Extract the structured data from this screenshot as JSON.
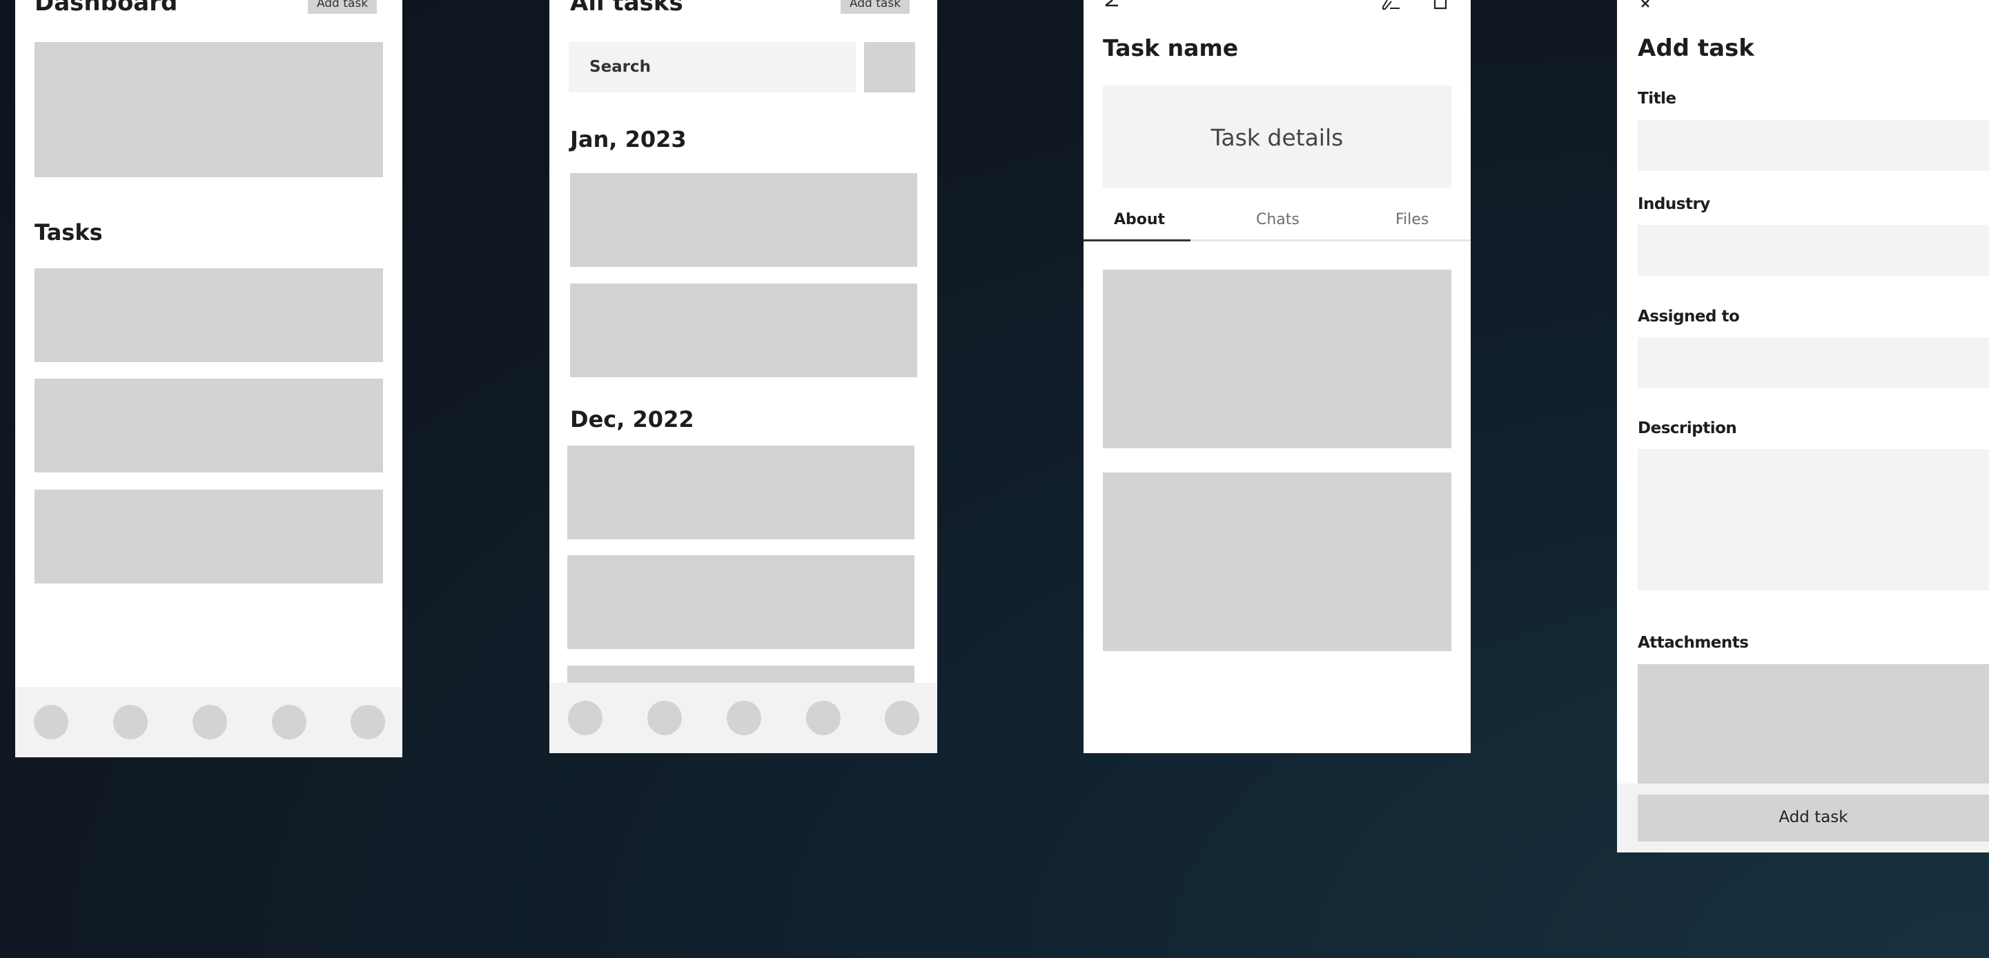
{
  "dashboard": {
    "title": "Dashboard",
    "add_task_button": "Add task",
    "tasks_heading": "Tasks"
  },
  "all_tasks": {
    "title": "All tasks",
    "add_task_button": "Add task",
    "search_placeholder": "Search",
    "group_1": "Jan, 2023",
    "group_2": "Dec, 2022"
  },
  "task_detail": {
    "task_name": "Task name",
    "details_label": "Task details",
    "tabs": [
      "About",
      "Chats",
      "Files"
    ],
    "active_tab": "About"
  },
  "add_task": {
    "title": "Add task",
    "fields": {
      "title": "Title",
      "industry": "Industry",
      "assigned_to": "Assigned to",
      "description": "Description",
      "attachments": "Attachments"
    },
    "submit_button": "Add task"
  },
  "icons": [
    "back-arrow-icon",
    "edit-icon",
    "delete-icon",
    "close-icon"
  ]
}
